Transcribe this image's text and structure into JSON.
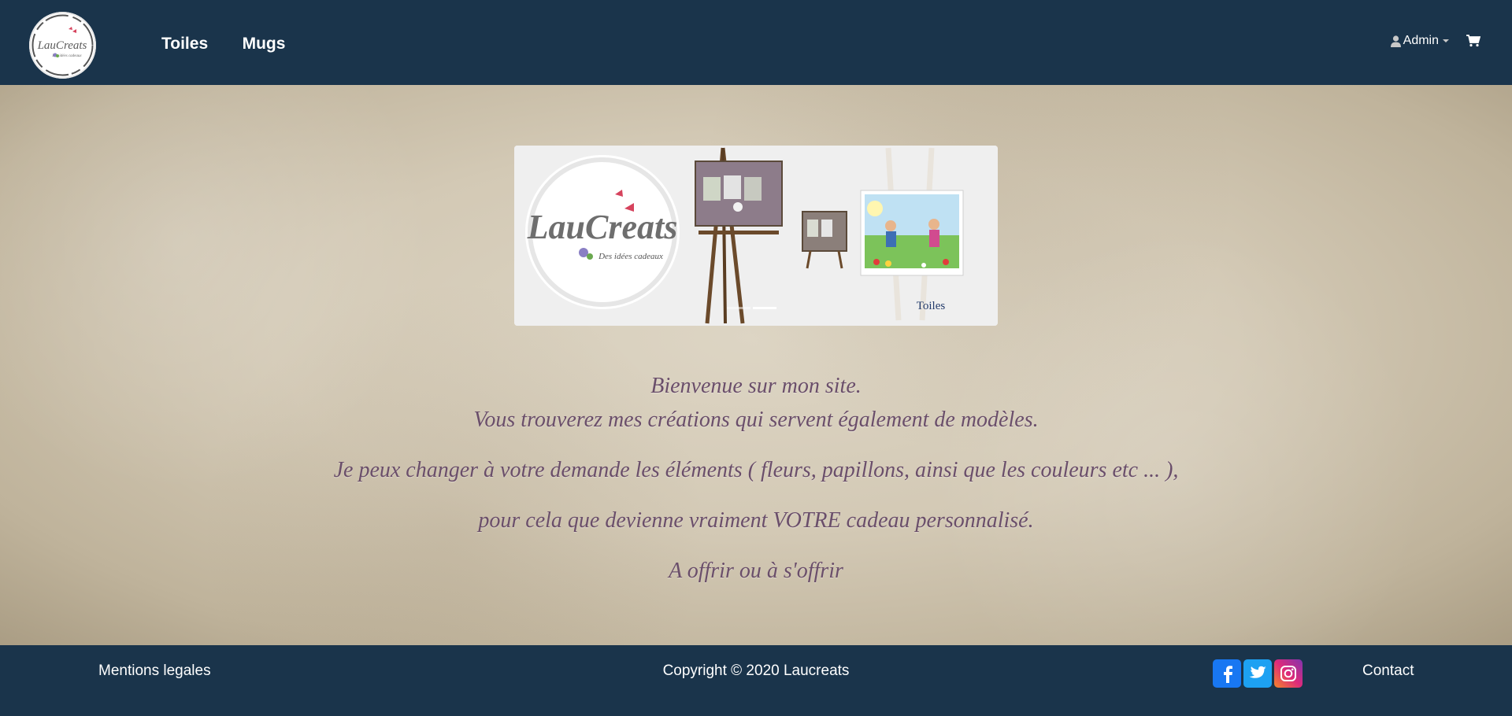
{
  "nav": {
    "logo": {
      "text": "LauCreats",
      "tagline": "Des idées cadeaux"
    },
    "links": [
      {
        "label": "Toiles"
      },
      {
        "label": "Mugs"
      }
    ],
    "user_label": "Admin",
    "user_icon": "user-icon",
    "cart_icon": "cart-icon"
  },
  "banner": {
    "logo_text": "LauCreats",
    "logo_tagline": "Des idées cadeaux",
    "caption": "Toiles",
    "slide_count": 2,
    "active_slide": 2
  },
  "welcome": {
    "lines": [
      "Bienvenue sur mon site.",
      "Vous trouverez mes créations qui servent également de modèles.",
      "Je peux changer à votre demande les éléments ( fleurs, papillons, ainsi que les couleurs etc ... ),",
      "pour cela que devienne vraiment VOTRE cadeau personnalisé.",
      "A offrir ou à s'offrir"
    ]
  },
  "footer": {
    "legal": "Mentions legales",
    "copyright": "Copyright © 2020 Laucreats",
    "social": [
      {
        "name": "facebook-icon",
        "color": "#1877f2"
      },
      {
        "name": "twitter-icon",
        "color": "#1da1f2"
      },
      {
        "name": "instagram-icon",
        "color": "#dd2a7b"
      }
    ],
    "contact": "Contact"
  },
  "colors": {
    "navbar": "#1a344b",
    "welcome_text": "#6a4e6a",
    "parchment": "#d3c9b5"
  }
}
